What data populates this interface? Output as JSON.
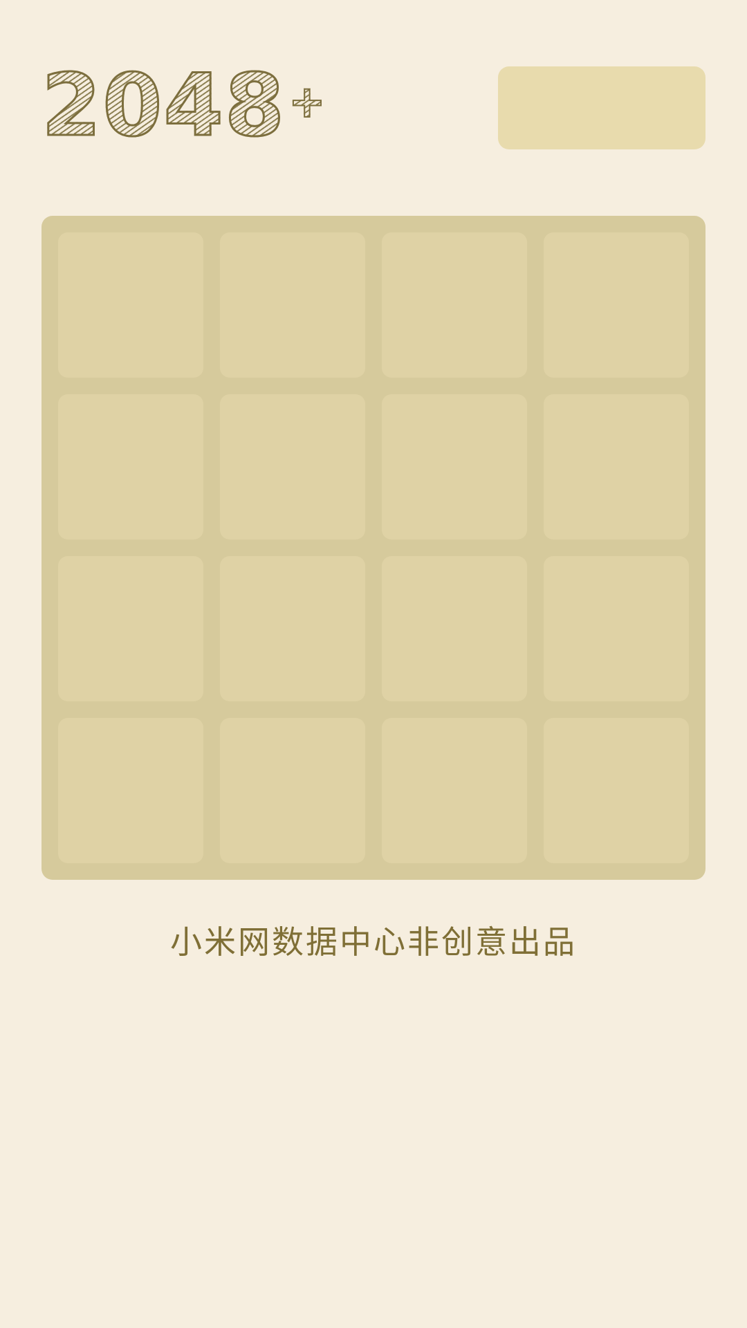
{
  "header": {
    "logo_number": "2048",
    "logo_plus": "+",
    "score_box_label": ""
  },
  "board": {
    "rows": 4,
    "cols": 4,
    "tiles": [
      [
        "",
        "",
        "",
        ""
      ],
      [
        "",
        "",
        "",
        ""
      ],
      [
        "",
        "",
        "",
        ""
      ],
      [
        "",
        "",
        "",
        ""
      ]
    ]
  },
  "footer": {
    "credit": "小米网数据中心非创意出品"
  },
  "colors": {
    "background": "#f6eedf",
    "board": "#d6ca9c",
    "empty_cell": "#dfd2a5",
    "score_box": "#e8dbad",
    "text": "#7f6f36"
  }
}
